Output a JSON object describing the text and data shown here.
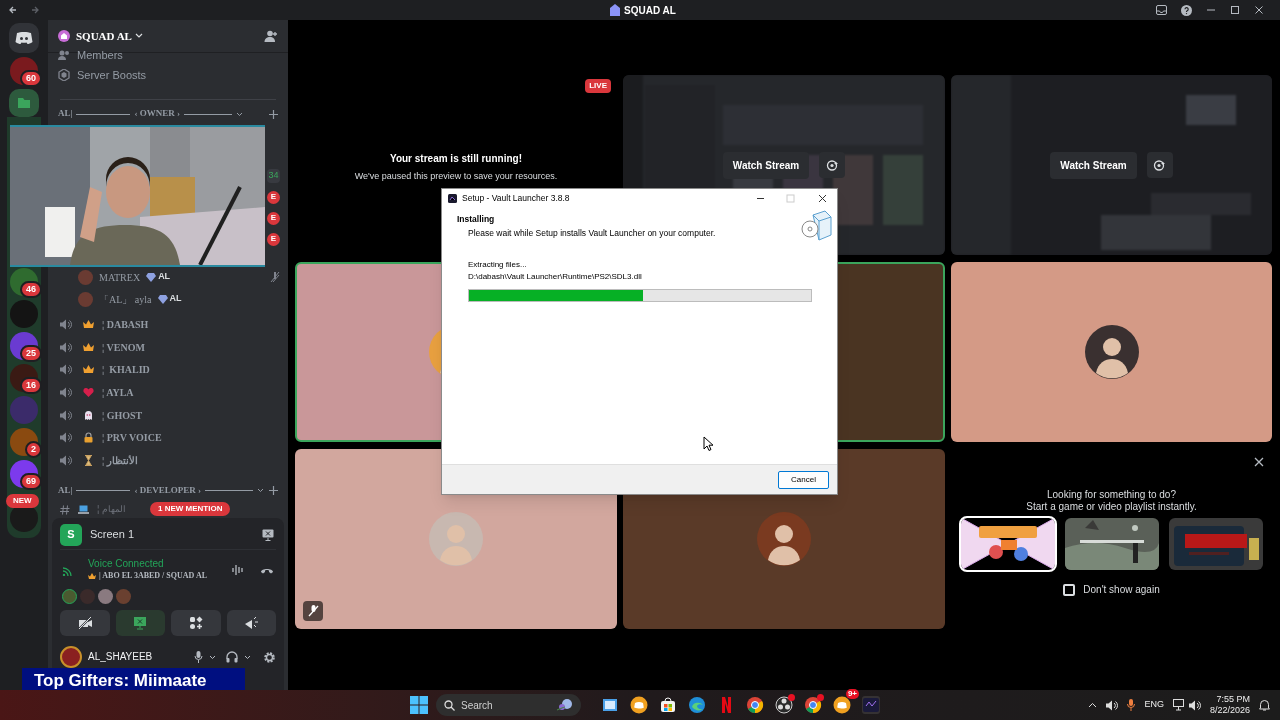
{
  "title_bar": {
    "title": "SQUAD AL"
  },
  "servers": [
    {
      "kind": "discord"
    },
    {
      "kind": "server",
      "color": "#7a1a1e",
      "badge": "60"
    },
    {
      "kind": "folder"
    },
    {
      "kind": "server",
      "color": "#2f6b2f",
      "badge": "46"
    },
    {
      "kind": "server",
      "color": "#141414"
    },
    {
      "kind": "server",
      "color": "#6a3bd1",
      "badge": "25"
    },
    {
      "kind": "server",
      "color": "#3a1a14",
      "badge": "16"
    },
    {
      "kind": "server",
      "color": "#3b2b6a"
    },
    {
      "kind": "server",
      "color": "#8a4a10",
      "badge": "2"
    },
    {
      "kind": "server",
      "color": "#7c3aed",
      "badge": "69"
    },
    {
      "kind": "server",
      "color": "#1a1a1a"
    }
  ],
  "new_pill": "NEW",
  "channel_panel": {
    "server_name": "SQUAD AL",
    "links": [
      {
        "kind": "members",
        "label": "Members"
      },
      {
        "kind": "boosts",
        "label": "Server Boosts"
      }
    ],
    "owner_category": {
      "prefix": "AL|",
      "name": "‹ OWNER ›"
    },
    "side_badges": [
      {
        "kind": "count",
        "text": "34"
      },
      {
        "kind": "tag",
        "text": "E"
      },
      {
        "kind": "tag",
        "text": "E"
      },
      {
        "kind": "tag",
        "text": "E"
      }
    ],
    "voice_members": [
      {
        "name": "MATREX",
        "tag": "AL"
      },
      {
        "name": "「AL」 ayla",
        "tag": "AL"
      }
    ],
    "voice_channels": [
      {
        "kind": "crown",
        "label": "¦ DABASH"
      },
      {
        "kind": "crown",
        "label": "¦ VENOM"
      },
      {
        "kind": "crown",
        "label": "¦  KHALID"
      },
      {
        "kind": "heart",
        "label": "¦ AYLA"
      },
      {
        "kind": "ghost",
        "label": "¦ GHOST"
      },
      {
        "kind": "lock",
        "label": "¦ PRV VOICE"
      },
      {
        "kind": "hourglass",
        "label": "¦ الأنتظار"
      }
    ],
    "developer_category": {
      "prefix": "AL|",
      "name": "‹ DEVELOPER ›"
    },
    "mention_pill": "1 NEW MENTION",
    "partial_channel": "¦ المهام"
  },
  "screen_share": {
    "icon_letter": "S",
    "label": "Screen 1"
  },
  "voice": {
    "status": "Voice Connected",
    "channel": "| ABO EL 3ABED / SQUAD AL"
  },
  "user": {
    "name": "AL_SHAYEEB"
  },
  "banner": "Top Gifters: Miimaate",
  "stage": {
    "live_badge": "LIVE",
    "paused_title": "Your stream is still running!",
    "paused_text": "We've paused this preview to save your resources.",
    "streams": [
      {
        "button": "Watch Stream"
      },
      {
        "button": "Watch Stream"
      }
    ],
    "tiles": [
      {
        "color": "#c99799",
        "speaking": true,
        "muted": false,
        "avatar": true
      },
      {
        "color": "#4a3422",
        "speaking": true,
        "muted": false,
        "avatar": false
      },
      {
        "color": "#d49a86",
        "speaking": false,
        "muted": false,
        "avatar": true
      },
      {
        "color": "#d2a79e",
        "speaking": false,
        "muted": true,
        "avatar": true
      },
      {
        "color": "#5a3a28",
        "speaking": false,
        "muted": false,
        "avatar": true
      }
    ],
    "promo": {
      "title": "Looking for something to do?",
      "text": "Start a game or video playlist instantly.",
      "dont_show": {
        "label": "Don't show again",
        "checked": false
      }
    }
  },
  "dialog": {
    "title": "Setup - Vault Launcher 3.8.8",
    "heading": "Installing",
    "subtitle": "Please wait while Setup installs Vault Launcher on your computer.",
    "status": "Extracting files...",
    "path": "D:\\dabash\\Vault Launcher\\Runtime\\PS2\\SDL3.dll",
    "level": 0.51,
    "cancel": "Cancel"
  },
  "taskbar": {
    "search": "Search",
    "apps": [
      {
        "kind": "media",
        "alert": false
      },
      {
        "kind": "discord",
        "alert": false
      },
      {
        "kind": "store",
        "alert": false
      },
      {
        "kind": "edge",
        "alert": false
      },
      {
        "kind": "netflix",
        "alert": false
      },
      {
        "kind": "chrome",
        "alert": false
      },
      {
        "kind": "obs",
        "alert": true
      },
      {
        "kind": "chrome",
        "alert": true
      },
      {
        "kind": "discord",
        "alert": false,
        "badge": "9+"
      },
      {
        "kind": "launcher",
        "alert": false
      }
    ],
    "language": "ENG",
    "time": "7:55 PM",
    "date": "8/22/2026"
  }
}
